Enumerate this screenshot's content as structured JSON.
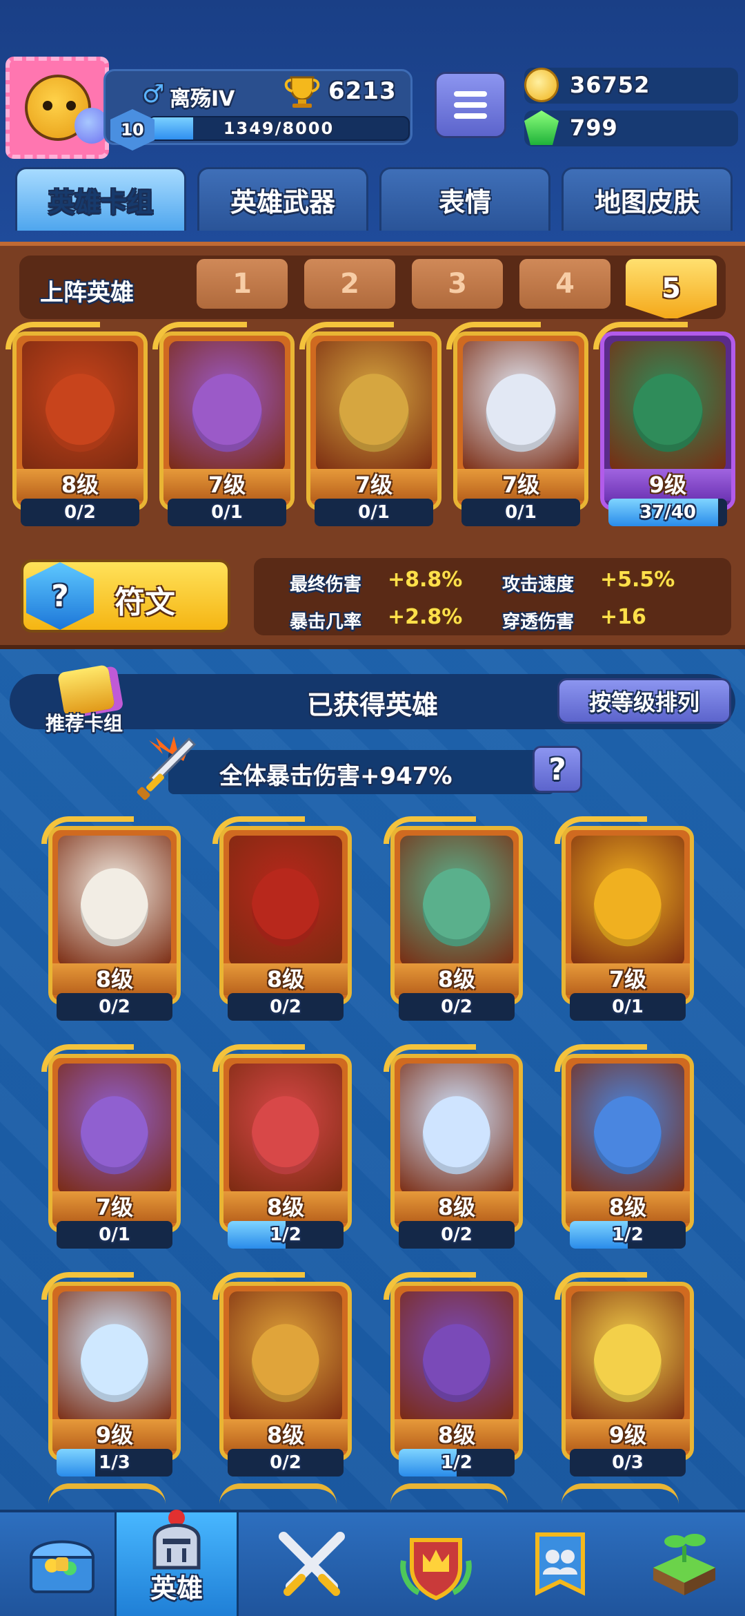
{
  "header": {
    "player_name": "离殇IV",
    "gender_symbol": "♂",
    "trophies": "6213",
    "level": "10",
    "xp_text": "1349/8000",
    "xp_progress": 0.169,
    "coins": "36752",
    "gems": "799"
  },
  "tabs": [
    {
      "label": "英雄卡组",
      "active": true
    },
    {
      "label": "英雄武器",
      "active": false
    },
    {
      "label": "表情",
      "active": false
    },
    {
      "label": "地图皮肤",
      "active": false
    }
  ],
  "lineup": {
    "title": "上阵英雄",
    "slots": [
      "1",
      "2",
      "3",
      "4",
      "5"
    ],
    "active_slot": "5",
    "heroes": [
      {
        "level": "8级",
        "progress_text": "0/2",
        "progress": 0,
        "art": "monkey-king",
        "color": "#c8441c"
      },
      {
        "level": "7级",
        "progress_text": "0/1",
        "progress": 0,
        "art": "geisha",
        "color": "#9b5ac8"
      },
      {
        "level": "7级",
        "progress_text": "0/1",
        "progress": 0,
        "art": "wooden-mask",
        "color": "#d6a640"
      },
      {
        "level": "7级",
        "progress_text": "0/1",
        "progress": 0,
        "art": "clown",
        "color": "#e2e8f4"
      },
      {
        "level": "9级",
        "progress_text": "37/40",
        "progress": 0.925,
        "art": "green-hat-ghost",
        "color": "#2f8c5a",
        "purple": true
      }
    ]
  },
  "runes": {
    "label": "符文",
    "icon": "rune-hexagon-icon",
    "stats": [
      {
        "name": "最终伤害",
        "value": "+8.8%"
      },
      {
        "name": "攻击速度",
        "value": "+5.5%"
      },
      {
        "name": "暴击几率",
        "value": "+2.8%"
      },
      {
        "name": "穿透伤害",
        "value": "+16"
      }
    ]
  },
  "collection": {
    "recommend_label": "推荐卡组",
    "title": "已获得英雄",
    "sort_label": "按等级排列",
    "crit_text": "全体暴击伤害+947%",
    "help_label": "?",
    "heroes": [
      {
        "level": "8级",
        "progress_text": "0/2",
        "progress": 0,
        "art": "old-sage",
        "color": "#f2ede4"
      },
      {
        "level": "8级",
        "progress_text": "0/2",
        "progress": 0,
        "art": "fan-girl",
        "color": "#b8281c"
      },
      {
        "level": "8级",
        "progress_text": "0/2",
        "progress": 0,
        "art": "police-sunglasses",
        "color": "#5ab08c"
      },
      {
        "level": "7级",
        "progress_text": "0/1",
        "progress": 0,
        "art": "golden-ninja",
        "color": "#f0b020"
      },
      {
        "level": "7级",
        "progress_text": "0/1",
        "progress": 0,
        "art": "medusa",
        "color": "#9060d0"
      },
      {
        "level": "8级",
        "progress_text": "1/2",
        "progress": 0.5,
        "art": "red-bean-hat",
        "color": "#d84848"
      },
      {
        "level": "8级",
        "progress_text": "0/2",
        "progress": 0,
        "art": "zeus",
        "color": "#cfe4ff"
      },
      {
        "level": "8级",
        "progress_text": "1/2",
        "progress": 0.5,
        "art": "ice-knight",
        "color": "#4a86e0"
      },
      {
        "level": "9级",
        "progress_text": "1/3",
        "progress": 0.333,
        "art": "yeti",
        "color": "#cfe8ff"
      },
      {
        "level": "8级",
        "progress_text": "0/2",
        "progress": 0,
        "art": "cowboy",
        "color": "#e0a43a"
      },
      {
        "level": "8级",
        "progress_text": "1/2",
        "progress": 0.5,
        "art": "octopus-pirate",
        "color": "#7a4ab8"
      },
      {
        "level": "9级",
        "progress_text": "0/3",
        "progress": 0,
        "art": "hooded-mage",
        "color": "#f3d04a"
      }
    ]
  },
  "bottom_nav": [
    {
      "icon": "treasure-chest-icon",
      "label": ""
    },
    {
      "icon": "knight-helmet-icon",
      "label": "英雄",
      "active": true
    },
    {
      "icon": "crossed-swords-icon",
      "label": ""
    },
    {
      "icon": "crown-shield-icon",
      "label": ""
    },
    {
      "icon": "team-banner-icon",
      "label": ""
    },
    {
      "icon": "sprout-island-icon",
      "label": ""
    }
  ]
}
